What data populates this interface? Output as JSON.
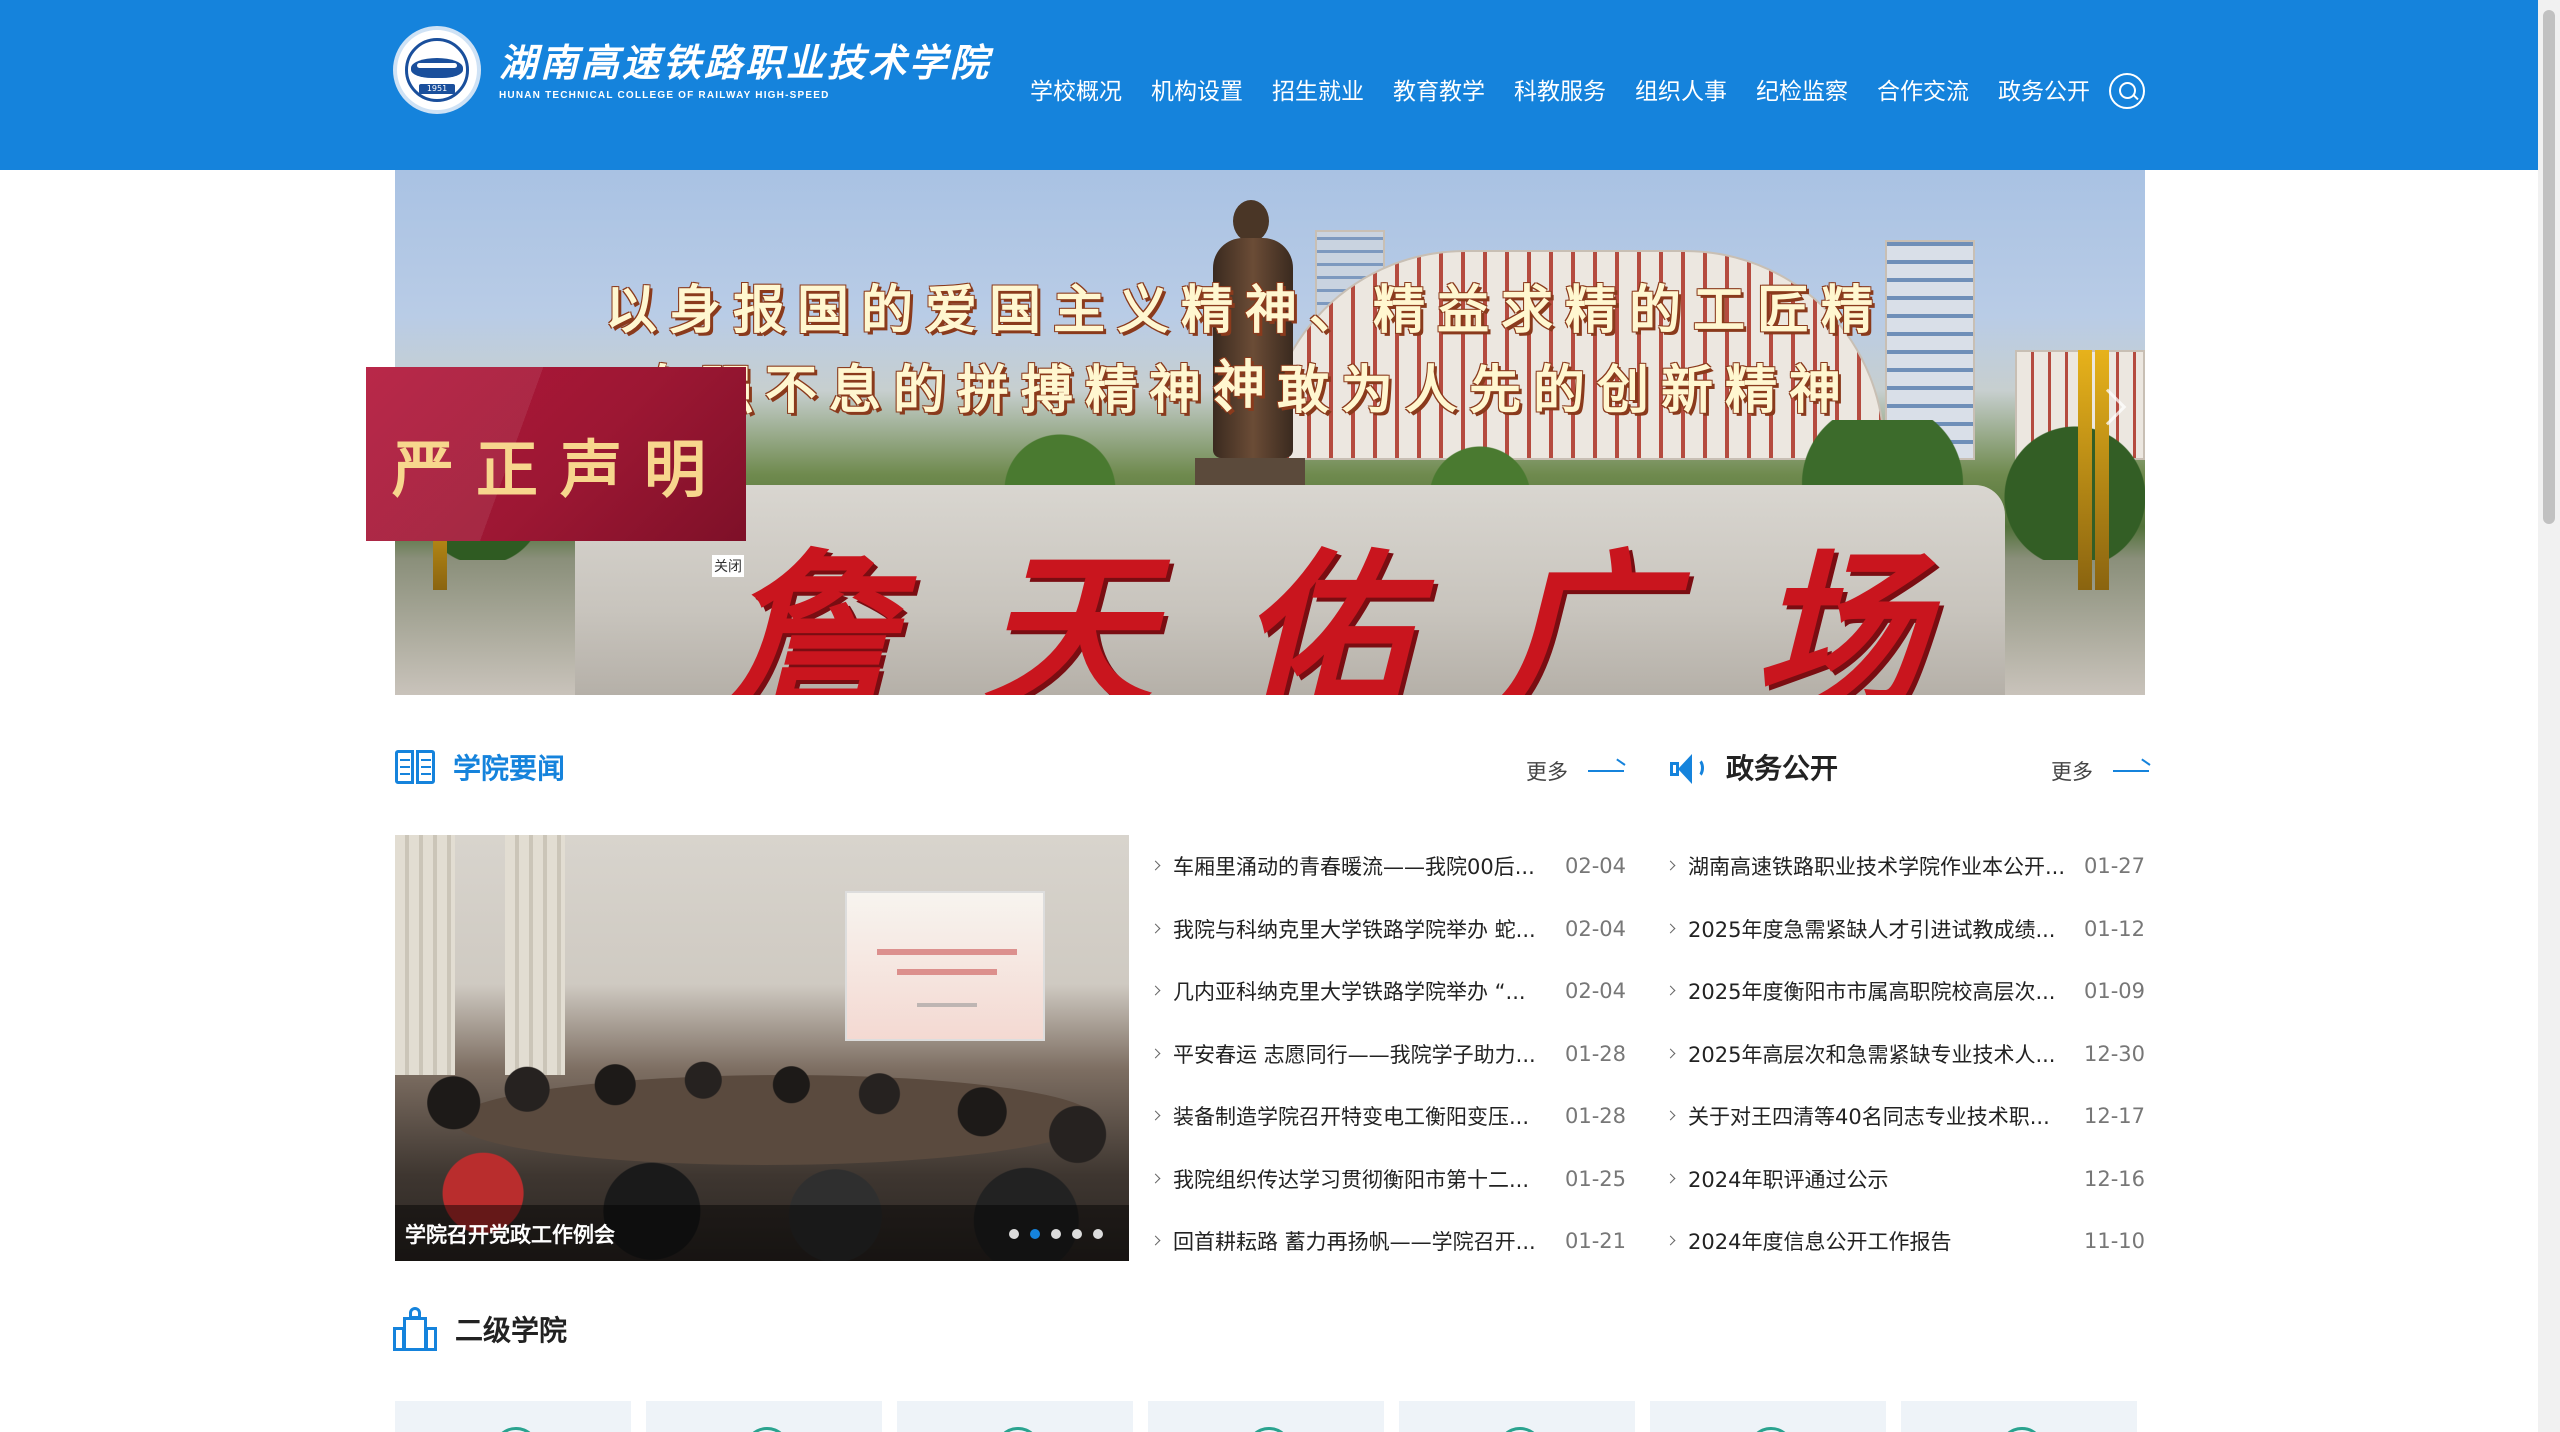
{
  "header": {
    "logo_cn": "湖南高速铁路职业技术学院",
    "logo_en": "HUNAN TECHNICAL COLLEGE OF RAILWAY HIGH-SPEED",
    "logo_year": "1951",
    "nav": [
      "学校概况",
      "机构设置",
      "招生就业",
      "教育教学",
      "科教服务",
      "组织人事",
      "纪检监察",
      "合作交流",
      "政务公开"
    ]
  },
  "banner": {
    "slogan_line1": "以身报国的爱国主义精神、精益求精的工匠精神",
    "slogan_line2": "自强不息的拼搏精神、敢为人先的创新精神",
    "stone_text": [
      "詹",
      "天",
      "佑",
      "广",
      "场"
    ]
  },
  "notice": {
    "text": "严正声明",
    "close_label": "关闭"
  },
  "news_section": {
    "title": "学院要闻",
    "more_label": "更多",
    "photo_caption": "学院召开党政工作例会",
    "slide_count": 5,
    "active_slide": 1,
    "items": [
      {
        "title": "车厢里涌动的青春暖流——我院00后...",
        "date": "02-04"
      },
      {
        "title": "我院与科纳克里大学铁路学院举办 蛇...",
        "date": "02-04"
      },
      {
        "title": "几内亚科纳克里大学铁路学院举办 “...",
        "date": "02-04"
      },
      {
        "title": "平安春运 志愿同行——我院学子助力...",
        "date": "01-28"
      },
      {
        "title": "装备制造学院召开特变电工衡阳变压...",
        "date": "01-28"
      },
      {
        "title": "我院组织传达学习贯彻衡阳市第十二...",
        "date": "01-25"
      },
      {
        "title": "回首耕耘路 蓄力再扬帆——学院召开...",
        "date": "01-21"
      }
    ]
  },
  "gov_section": {
    "title": "政务公开",
    "more_label": "更多",
    "items": [
      {
        "title": "湖南高速铁路职业技术学院作业本公开...",
        "date": "01-27"
      },
      {
        "title": "2025年度急需紧缺人才引进试教成绩...",
        "date": "01-12"
      },
      {
        "title": "2025年度衡阳市市属高职院校高层次...",
        "date": "01-09"
      },
      {
        "title": "2025年高层次和急需紧缺专业技术人...",
        "date": "12-30"
      },
      {
        "title": "关于对王四清等40名同志专业技术职...",
        "date": "12-17"
      },
      {
        "title": "2024年职评通过公示",
        "date": "12-16"
      },
      {
        "title": "2024年度信息公开工作报告",
        "date": "11-10"
      }
    ]
  },
  "college_section": {
    "title": "二级学院",
    "card_count": 7
  },
  "colors": {
    "brand_blue": "#1583dc",
    "notice_red": "#9c1733",
    "notice_gold": "#f7d68d"
  }
}
